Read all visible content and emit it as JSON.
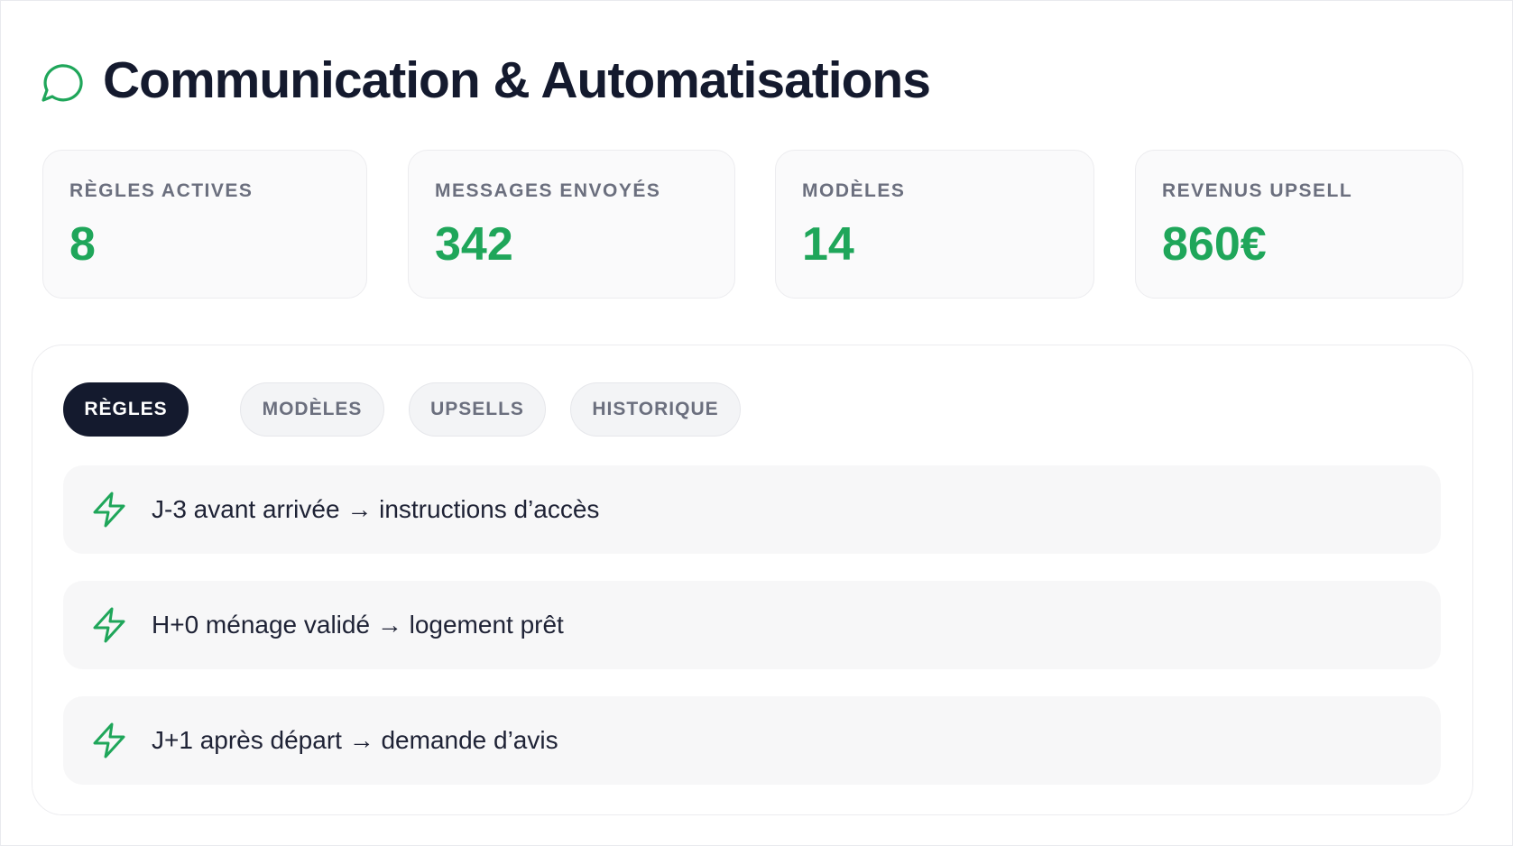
{
  "header": {
    "title": "Communication & Automatisations",
    "icon": "chat-bubble-icon",
    "accent_color": "#1fa65a"
  },
  "stats": [
    {
      "label": "RÈGLES ACTIVES",
      "value": "8"
    },
    {
      "label": "MESSAGES ENVOYÉS",
      "value": "342"
    },
    {
      "label": "MODÈLES",
      "value": "14"
    },
    {
      "label": "REVENUS UPSELL",
      "value": "860€"
    }
  ],
  "tabs": [
    {
      "label": "RÈGLES",
      "active": true
    },
    {
      "label": "MODÈLES",
      "active": false
    },
    {
      "label": "UPSELLS",
      "active": false
    },
    {
      "label": "HISTORIQUE",
      "active": false
    }
  ],
  "rules": [
    {
      "icon": "lightning-icon",
      "text": "J-3 avant arrivée → instructions d’accès"
    },
    {
      "icon": "lightning-icon",
      "text": "H+0 ménage validé → logement prêt"
    },
    {
      "icon": "lightning-icon",
      "text": "J+1 après départ → demande d’avis"
    }
  ],
  "colors": {
    "value_green": "#1fa65a",
    "active_tab": "#141a2e",
    "label_gray": "#6b6f7e"
  }
}
